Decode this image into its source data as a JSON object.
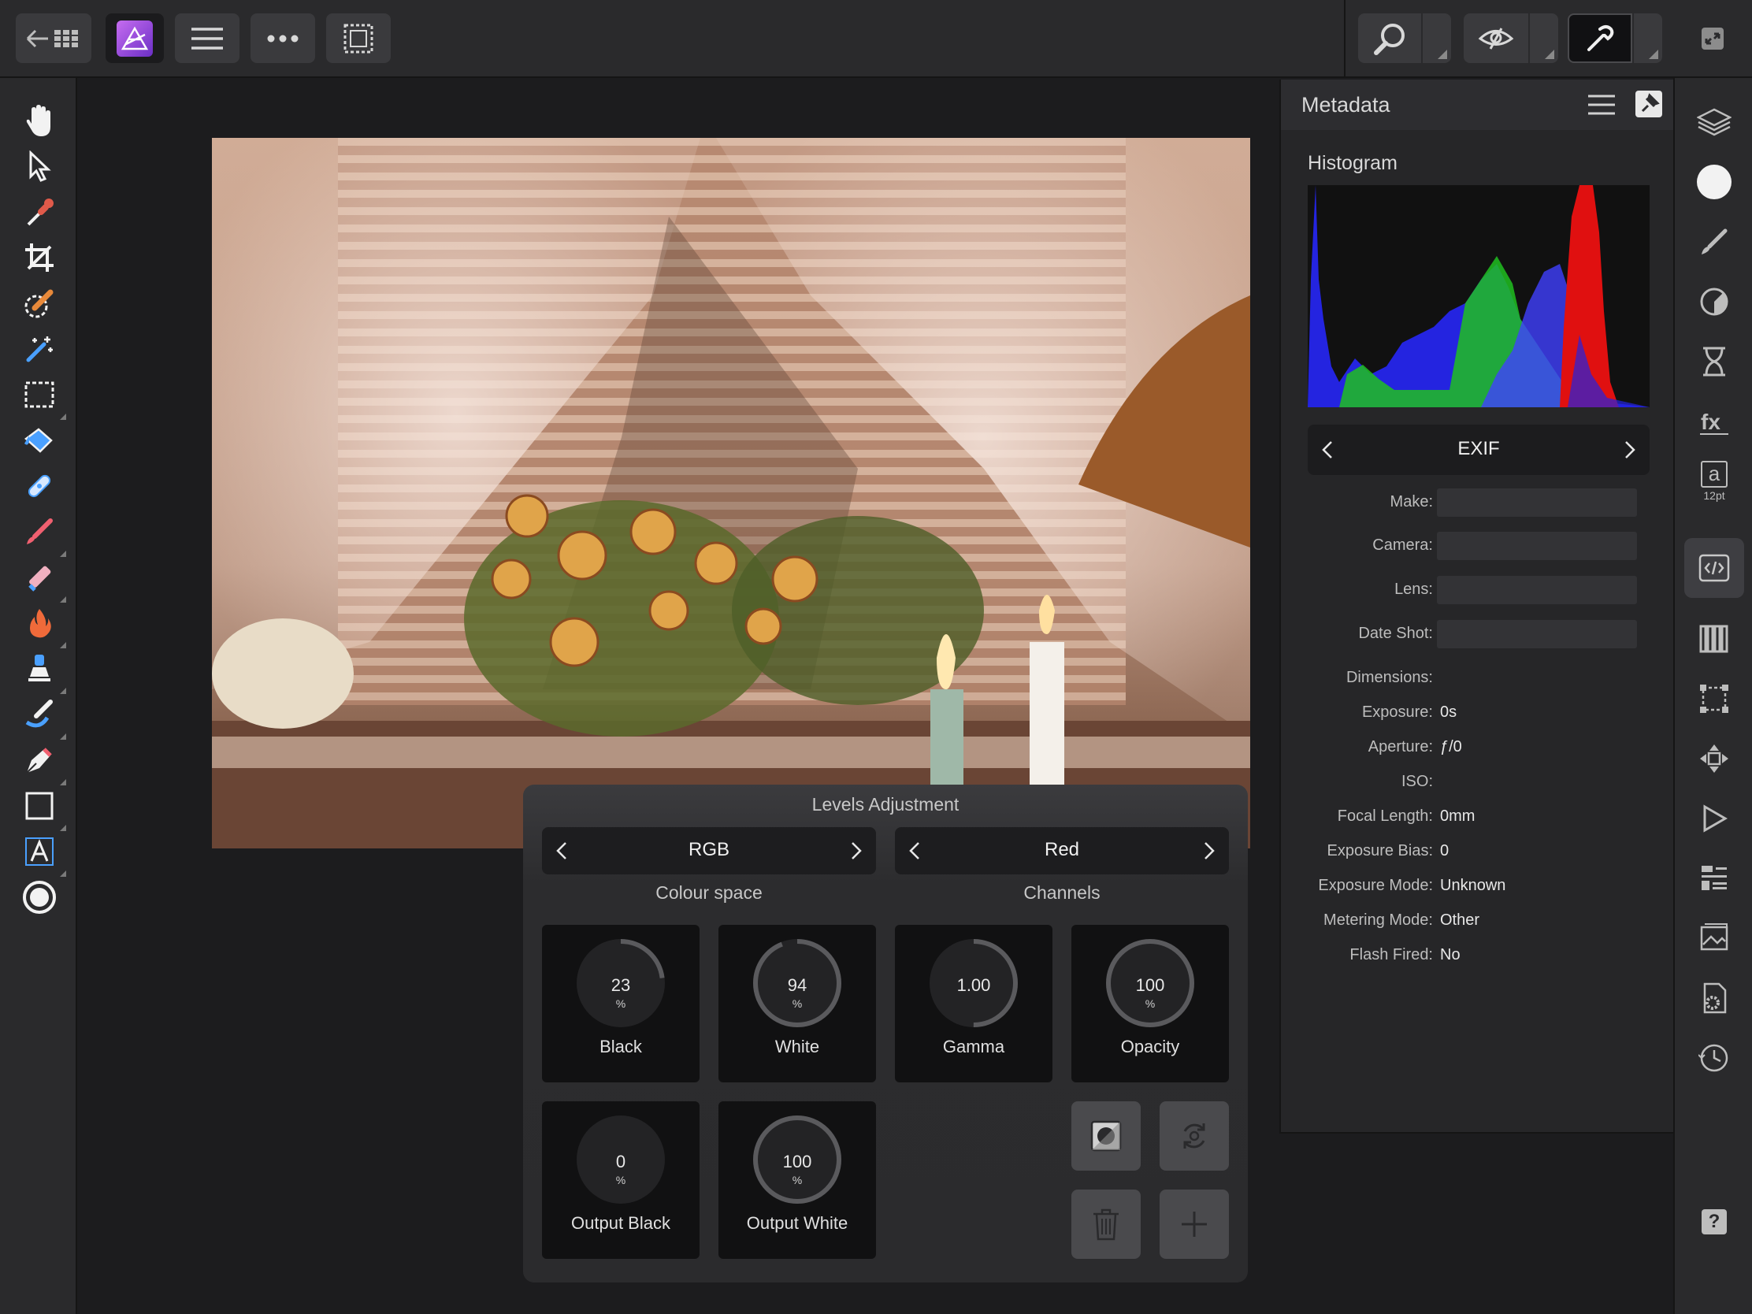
{
  "toolbar": {
    "icons": [
      "back-grid-icon",
      "app-logo-icon",
      "menu-icon",
      "more-icon",
      "selection-icon",
      "zoom-icon",
      "view-mode-icon",
      "assistant-icon",
      "fullscreen-icon"
    ]
  },
  "tools": [
    "hand-icon",
    "move-icon",
    "color-picker-icon",
    "crop-icon",
    "selection-brush-icon",
    "magic-wand-icon",
    "marquee-icon",
    "flood-fill-icon",
    "healing-icon",
    "paint-brush-icon",
    "erase-brush-icon",
    "burn-icon",
    "clone-icon",
    "smudge-icon",
    "pen-icon",
    "rectangle-icon",
    "artistic-text-icon",
    "color-circle-icon"
  ],
  "studio": {
    "icons": [
      "layers-icon",
      "color-icon",
      "brushes-icon",
      "adjustments-icon",
      "history-icon",
      "fx-icon",
      "text-style-icon",
      "metadata-icon",
      "channels-icon",
      "transform-icon",
      "navigator-icon",
      "macro-icon",
      "stock-icon",
      "library-icon",
      "settings-icon",
      "snapshots-icon",
      "help-icon"
    ],
    "text_style_label": "a",
    "text_style_size": "12pt",
    "help_label": "?"
  },
  "metadata": {
    "title": "Metadata",
    "histogram_label": "Histogram",
    "tab_label": "EXIF",
    "fields": [
      {
        "label": "Make:",
        "value": "",
        "field": true
      },
      {
        "label": "Camera:",
        "value": "",
        "field": true
      },
      {
        "label": "Lens:",
        "value": "",
        "field": true
      },
      {
        "label": "Date Shot:",
        "value": "",
        "field": true
      },
      {
        "label": "Dimensions:",
        "value": "",
        "field": false
      },
      {
        "label": "Exposure:",
        "value": "0s",
        "field": false
      },
      {
        "label": "Aperture:",
        "value": "ƒ/0",
        "field": false
      },
      {
        "label": "ISO:",
        "value": "",
        "field": false
      },
      {
        "label": "Focal Length:",
        "value": "0mm",
        "field": false
      },
      {
        "label": "Exposure Bias:",
        "value": "0",
        "field": false
      },
      {
        "label": "Exposure Mode:",
        "value": "Unknown",
        "field": false
      },
      {
        "label": "Metering Mode:",
        "value": "Other",
        "field": false
      },
      {
        "label": "Flash Fired:",
        "value": "No",
        "field": false
      }
    ]
  },
  "levels": {
    "title": "Levels Adjustment",
    "colour_space": {
      "value": "RGB",
      "caption": "Colour space"
    },
    "channels": {
      "value": "Red",
      "caption": "Channels"
    },
    "dials": [
      {
        "name": "Black",
        "value": "23",
        "unit": "%",
        "fraction": 0.23
      },
      {
        "name": "White",
        "value": "94",
        "unit": "%",
        "fraction": 0.94
      },
      {
        "name": "Gamma",
        "value": "1.00",
        "unit": "",
        "fraction": 0.5
      },
      {
        "name": "Opacity",
        "value": "100",
        "unit": "%",
        "fraction": 1.0
      },
      {
        "name": "Output Black",
        "value": "0",
        "unit": "%",
        "fraction": 0.0
      },
      {
        "name": "Output White",
        "value": "100",
        "unit": "%",
        "fraction": 1.0
      }
    ],
    "buttons": [
      "mask-icon",
      "reset-icon",
      "delete-icon",
      "add-icon"
    ]
  }
}
